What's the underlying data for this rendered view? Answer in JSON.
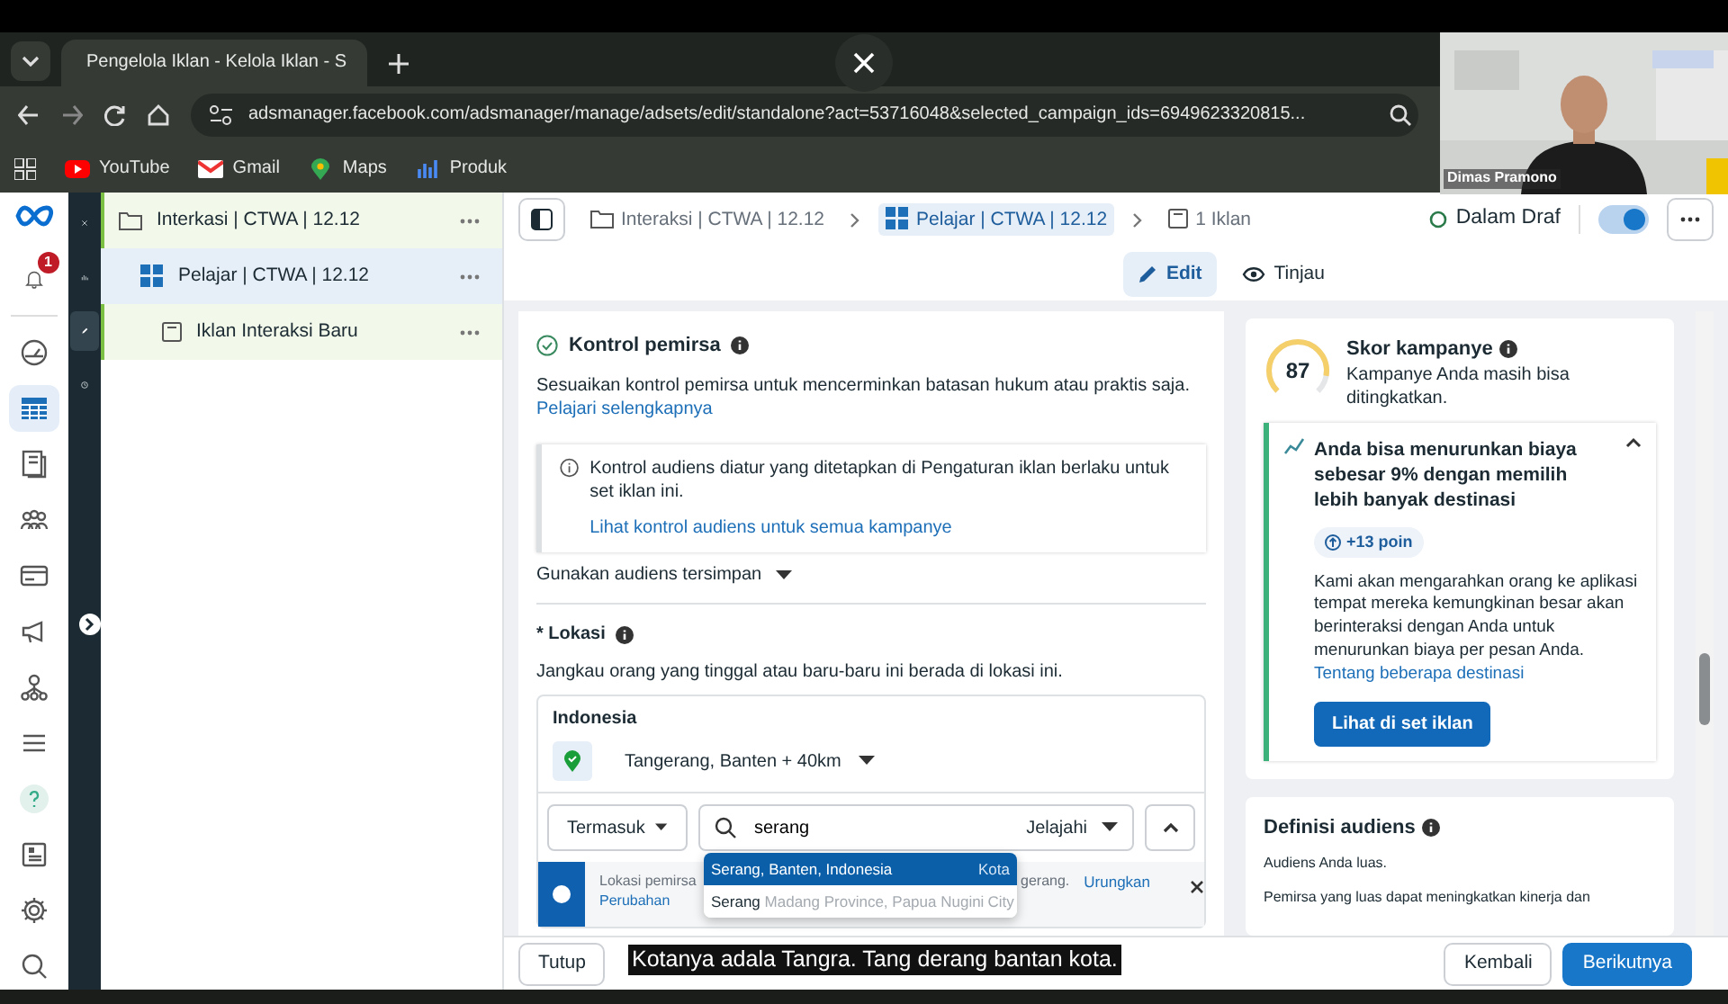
{
  "browser": {
    "tabs": [
      {
        "title": "Pengelola Iklan - Kelola Iklan - S",
        "selected": true
      }
    ],
    "url": "adsmanager.facebook.com/adsmanager/manage/adsets/edit/standalone?act=53716048&selected_campaign_ids=6949623320815...",
    "bookmarks": [
      {
        "label": "YouTube",
        "kind": "youtube"
      },
      {
        "label": "Gmail",
        "kind": "gmail"
      },
      {
        "label": "Maps",
        "kind": "maps"
      },
      {
        "label": "Produk",
        "kind": "produk"
      }
    ]
  },
  "video_overlay": {
    "presenter": "Dimas Pramono",
    "caption": "Kotanya adala Tangra. Tang derang bantan kota."
  },
  "nav_rail": {
    "notification_count": "1",
    "items": [
      {
        "kind": "gauge",
        "selected": false
      },
      {
        "kind": "table",
        "selected": true
      },
      {
        "kind": "pages",
        "selected": false
      },
      {
        "kind": "people",
        "selected": false
      },
      {
        "kind": "card",
        "selected": false
      },
      {
        "kind": "megaphone",
        "selected": false
      },
      {
        "kind": "network",
        "selected": false
      },
      {
        "kind": "menu",
        "selected": false
      },
      {
        "kind": "help",
        "selected": false
      },
      {
        "kind": "news",
        "selected": false
      },
      {
        "kind": "gear",
        "selected": false
      },
      {
        "kind": "search",
        "selected": false
      }
    ]
  },
  "tool_strip": [
    {
      "kind": "close",
      "selected": false
    },
    {
      "kind": "chart",
      "selected": false
    },
    {
      "kind": "pencil",
      "selected": true
    },
    {
      "kind": "clock",
      "selected": false
    }
  ],
  "tree": [
    {
      "label": "Interkasi | CTWA | 12.12",
      "kind": "campaign",
      "selected": false,
      "children": [
        {
          "label": "Pelajar | CTWA | 12.12",
          "kind": "adset",
          "selected": true,
          "children": [
            {
              "label": "Iklan Interaksi Baru",
              "kind": "ad",
              "selected": false
            }
          ]
        }
      ]
    }
  ],
  "breadcrumbs": [
    {
      "label": "Interaksi | CTWA | 12.12",
      "kind": "campaign",
      "selected": false
    },
    {
      "label": "Pelajar | CTWA | 12.12",
      "kind": "adset",
      "selected": true
    },
    {
      "label": "1 Iklan",
      "kind": "ad",
      "selected": false
    }
  ],
  "status": "Dalam Draf",
  "toggle_on": true,
  "mode_tabs": [
    {
      "label": "Edit",
      "kind": "edit",
      "selected": true
    },
    {
      "label": "Tinjau",
      "kind": "view",
      "selected": false
    }
  ],
  "audience_controls": {
    "title": "Kontrol pemirsa",
    "description": "Sesuaikan kontrol pemirsa untuk mencerminkan batasan hukum atau praktis saja.",
    "link": "Pelajari selengkapnya",
    "notice": "Kontrol audiens diatur yang ditetapkan di Pengaturan iklan berlaku untuk set iklan ini.",
    "notice_link": "Lihat kontrol audiens untuk semua kampanye",
    "saved_audience": "Gunakan audiens tersimpan"
  },
  "location": {
    "title": "* Lokasi",
    "description": "Jangkau orang yang tinggal atau baru-baru ini berada di lokasi ini.",
    "country": "Indonesia",
    "place": "Tangerang, Banten + 40km",
    "include_mode": "Termasuk",
    "search_value": "serang",
    "browse": "Jelajahi",
    "banner_left": "Lokasi pemirsa",
    "banner_right": "gerang.",
    "banner_link": "Urungkan",
    "banner_link_cut": "Perubahan",
    "suggestions": [
      {
        "name": "Serang, Banten, Indonesia",
        "type": "Kota",
        "selected": true
      },
      {
        "name": "Serang",
        "region": "Madang Province, Papua Nugini",
        "type": "City",
        "selected": false
      }
    ]
  },
  "campaign_score": {
    "score": "87",
    "level": 0.87,
    "title": "Skor kampanye",
    "subtitle": "Kampanye Anda masih bisa ditingkatkan.",
    "recommendation": {
      "title": "Anda bisa menurunkan biaya sebesar 9% dengan memilih lebih banyak destinasi",
      "expanded": true,
      "points": "+13 poin",
      "body": "Kami akan mengarahkan orang ke aplikasi tempat mereka kemungkinan besar akan berinteraksi dengan Anda untuk menurunkan biaya per pesan Anda.",
      "link": "Tentang beberapa destinasi",
      "button": "Lihat di set iklan"
    }
  },
  "audience_definition": {
    "title": "Definisi audiens",
    "summary": "Audiens Anda luas.",
    "detail": "Pemirsa yang luas dapat meningkatkan kinerja dan"
  },
  "footer": {
    "close": "Tutup",
    "back": "Kembali",
    "next": "Berikutnya"
  }
}
